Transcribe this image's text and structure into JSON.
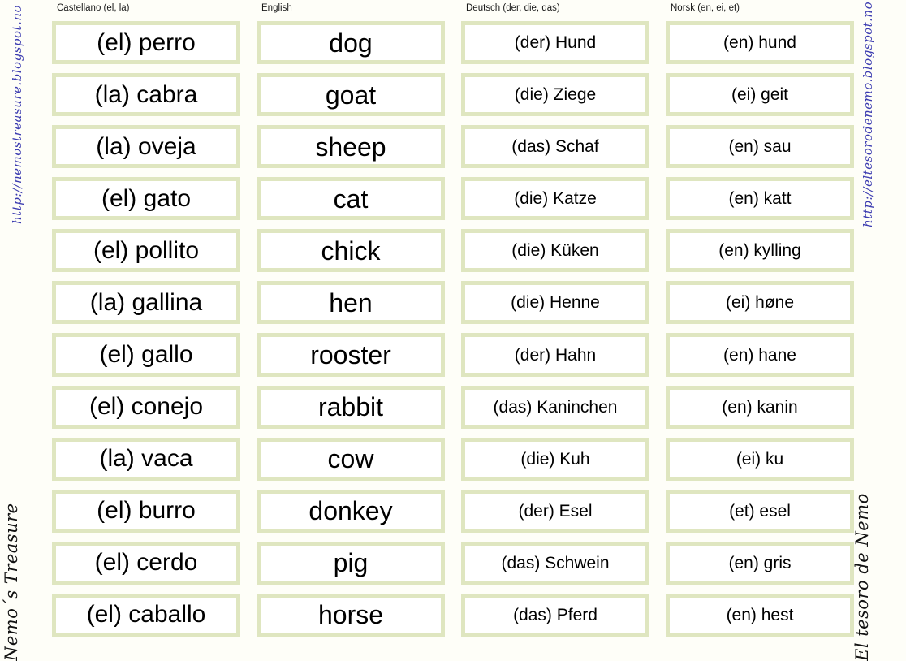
{
  "colors": {
    "card_border": "#dfe6c0",
    "card_fill": "#ffffff",
    "page_background": "#fefef8",
    "url_text": "#3b3bb0",
    "brand_text": "#121212"
  },
  "watermarks": {
    "left_url": "http://nemostreasure.blogspot.no",
    "left_brand": "Nemo´s Treasure",
    "right_url": "http://eltesorodenemo.blogspot.no",
    "right_brand": "El tesoro de Nemo"
  },
  "columns": [
    {
      "key": "castellano",
      "header": "Castellano (el, la)",
      "cards": [
        "(el) perro",
        "(la) cabra",
        "(la) oveja",
        "(el) gato",
        "(el) pollito",
        "(la) gallina",
        "(el) gallo",
        "(el) conejo",
        "(la) vaca",
        "(el) burro",
        "(el) cerdo",
        "(el) caballo"
      ]
    },
    {
      "key": "english",
      "header": "English",
      "cards": [
        "dog",
        "goat",
        "sheep",
        "cat",
        "chick",
        "hen",
        "rooster",
        "rabbit",
        "cow",
        "donkey",
        "pig",
        "horse"
      ]
    },
    {
      "key": "deutsch",
      "header": "Deutsch (der, die, das)",
      "cards": [
        "(der) Hund",
        "(die) Ziege",
        "(das) Schaf",
        "(die) Katze",
        "(die) Küken",
        "(die) Henne",
        "(der) Hahn",
        "(das) Kaninchen",
        "(die) Kuh",
        "(der) Esel",
        "(das) Schwein",
        "(das) Pferd"
      ]
    },
    {
      "key": "norsk",
      "header": "Norsk (en, ei, et)",
      "cards": [
        "(en) hund",
        "(ei) geit",
        "(en) sau",
        "(en) katt",
        "(en) kylling",
        "(ei) høne",
        "(en) hane",
        "(en) kanin",
        "(ei) ku",
        "(et) esel",
        "(en) gris",
        "(en) hest"
      ]
    }
  ]
}
